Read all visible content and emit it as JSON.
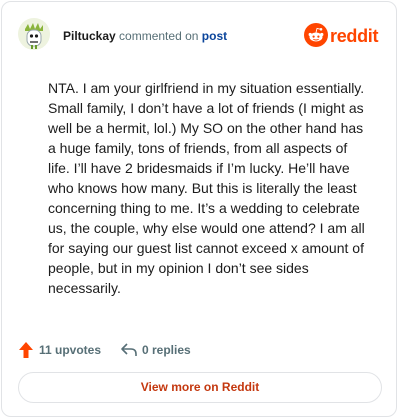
{
  "header": {
    "username": "Piltuckay",
    "action_text": "commented on",
    "post_link": "post",
    "brand": "reddit"
  },
  "comment": {
    "body": "NTA. I am your girlfriend in my situation essentially. Small family, I don’t have a lot of friends (I might as well be a hermit, lol.) My SO on the other hand has a huge family, tons of friends, from all aspects of life. I’ll have 2 bridesmaids if I’m lucky. He’ll have who knows how many. But this is literally the least concerning thing to me. It’s a wedding to celebrate us, the couple, why else would one attend? I am all for saying our guest list cannot exceed x amount of people, but in my opinion I don’t see sides necessarily."
  },
  "actions": {
    "upvotes": "11 upvotes",
    "replies": "0 replies"
  },
  "footer": {
    "view_more": "View more on Reddit"
  },
  "colors": {
    "brand": "#ff4500",
    "link": "#0a449b",
    "muted": "#576f76",
    "cta": "#c4380f"
  },
  "icons": {
    "avatar": "avatar",
    "logo": "reddit-snoo-icon",
    "upvote": "upvote-arrow-icon",
    "reply": "reply-arrow-icon"
  }
}
